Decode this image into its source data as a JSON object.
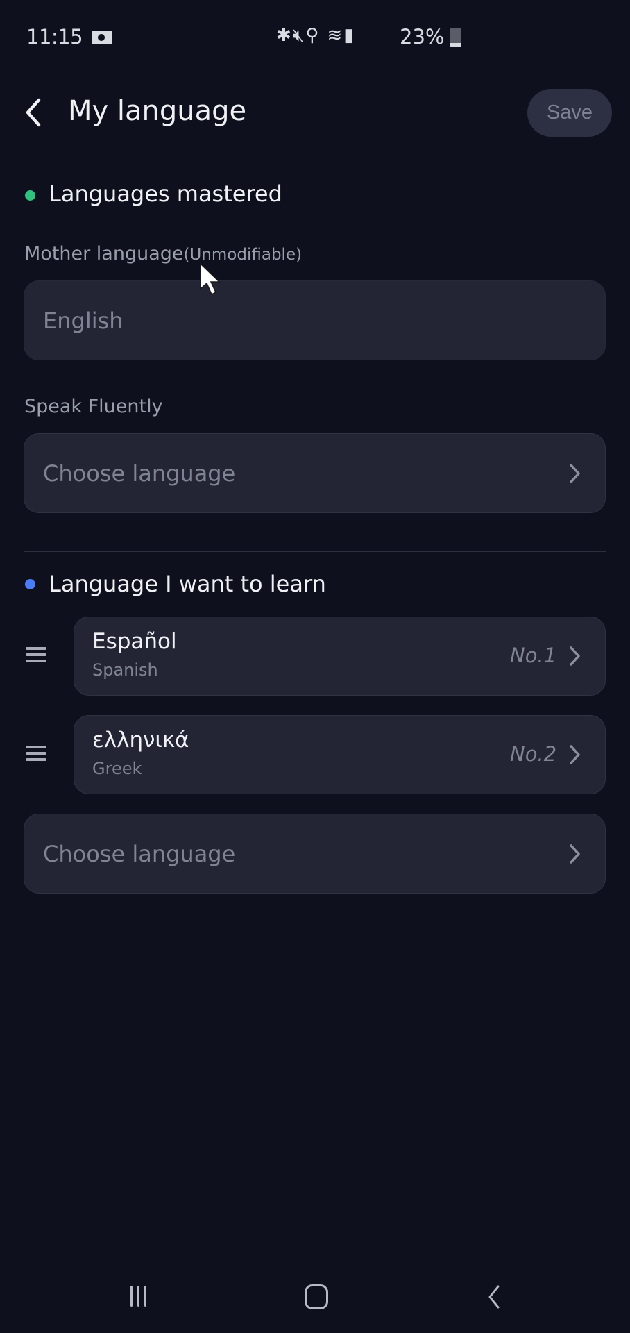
{
  "status_bar": {
    "time": "11:15",
    "recording_icon": "video-camera-icon",
    "icons": [
      "bluetooth-icon",
      "mute-icon",
      "location-icon",
      "wifi-icon",
      "signal-icon"
    ],
    "battery_text": "23%",
    "battery_level_percent": 23
  },
  "header": {
    "back_icon": "chevron-left-icon",
    "title": "My language",
    "save_label": "Save"
  },
  "mastered": {
    "title": "Languages mastered",
    "dot_color": "#2ec27e",
    "mother_label": "Mother language",
    "mother_note": "(Unmodifiable)",
    "mother_value": "English",
    "fluent_label": "Speak Fluently",
    "fluent_placeholder": "Choose language"
  },
  "learn": {
    "title": "Language I want to learn",
    "dot_color": "#4a7cf5",
    "items": [
      {
        "native": "Español",
        "english": "Spanish",
        "rank": "No.1"
      },
      {
        "native": "ελληνικά",
        "english": "Greek",
        "rank": "No.2"
      }
    ],
    "add_placeholder": "Choose language"
  },
  "nav_bar": {
    "recent_icon": "recent-apps-icon",
    "home_icon": "home-icon",
    "back_icon": "back-icon"
  }
}
